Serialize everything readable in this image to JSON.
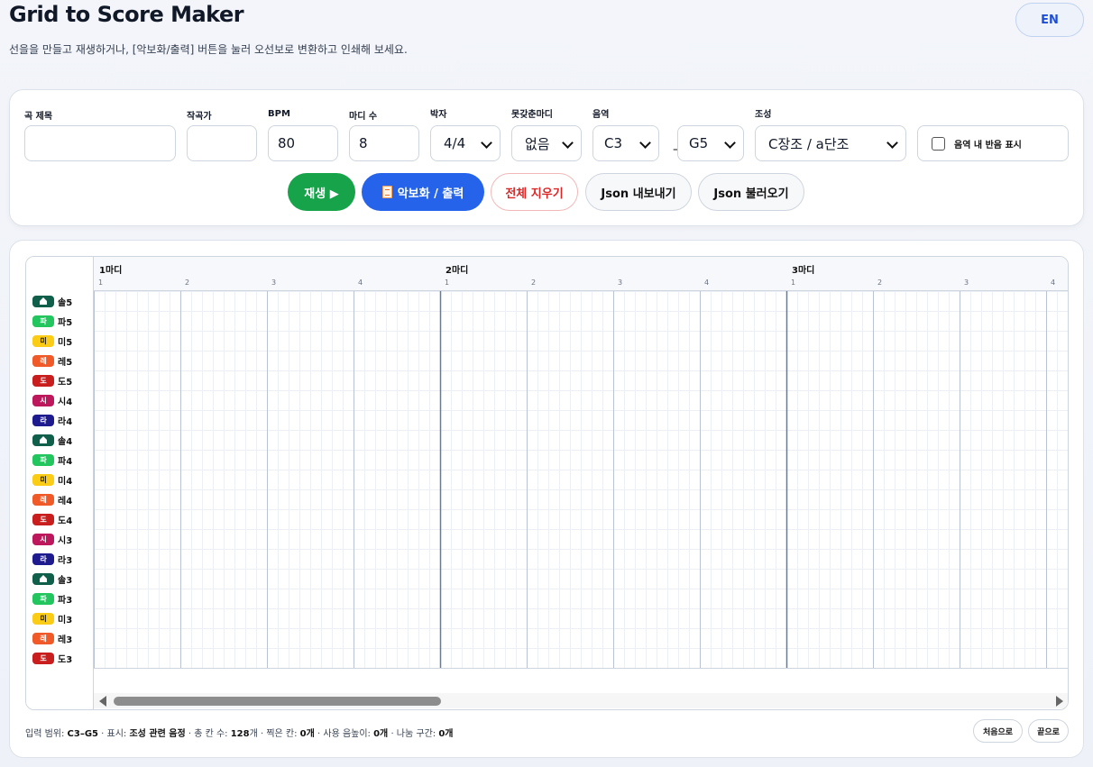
{
  "app": {
    "title": "Grid to Score Maker",
    "subtitle": "선을을 만들고 재생하거나, [악보화/출력] 버튼을 눌러 오선보로 변환하고 인쇄해 보세요.",
    "lang_button": "EN"
  },
  "settings": {
    "song_title": {
      "label": "곡 제목",
      "value": ""
    },
    "composer": {
      "label": "작곡가",
      "value": ""
    },
    "bpm": {
      "label": "BPM",
      "value": "80"
    },
    "measures": {
      "label": "마디 수",
      "value": "8"
    },
    "time_signature": {
      "label": "박자",
      "value": "4/4"
    },
    "pickup": {
      "label": "못갖춘마디",
      "value": "없음"
    },
    "range": {
      "label": "음역",
      "low": "C3",
      "high": "G5",
      "separator": "–"
    },
    "key": {
      "label": "조성",
      "value": "C장조 / a단조"
    },
    "show_semitones": {
      "label": "음역 내 반음 표시",
      "checked": false
    }
  },
  "buttons": {
    "play": "재생 ▶",
    "score": "악보화 / 출력",
    "clear": "전체 지우기",
    "export_json": "Json 내보내기",
    "import_json": "Json 불러오기"
  },
  "grid": {
    "measures": [
      "1마디",
      "2마디",
      "3마디"
    ],
    "beats": [
      "1",
      "2",
      "3",
      "4",
      "1",
      "2",
      "3",
      "4",
      "1",
      "2",
      "3",
      "4"
    ],
    "rows": [
      {
        "badge": "",
        "label": "솔5",
        "color": "#0f5f4a",
        "icon": "home-icon"
      },
      {
        "badge": "파",
        "label": "파5",
        "color": "#22c55e"
      },
      {
        "badge": "미",
        "label": "미5",
        "color": "#facc15"
      },
      {
        "badge": "레",
        "label": "레5",
        "color": "#f05a28"
      },
      {
        "badge": "도",
        "label": "도5",
        "color": "#c81e1e"
      },
      {
        "badge": "시",
        "label": "시4",
        "color": "#be185d"
      },
      {
        "badge": "라",
        "label": "라4",
        "color": "#1e1b8f"
      },
      {
        "badge": "",
        "label": "솔4",
        "color": "#0f5f4a",
        "icon": "home-icon"
      },
      {
        "badge": "파",
        "label": "파4",
        "color": "#22c55e"
      },
      {
        "badge": "미",
        "label": "미4",
        "color": "#facc15"
      },
      {
        "badge": "레",
        "label": "레4",
        "color": "#f05a28"
      },
      {
        "badge": "도",
        "label": "도4",
        "color": "#c81e1e"
      },
      {
        "badge": "시",
        "label": "시3",
        "color": "#be185d"
      },
      {
        "badge": "라",
        "label": "라3",
        "color": "#1e1b8f"
      },
      {
        "badge": "",
        "label": "솔3",
        "color": "#0f5f4a",
        "icon": "home-icon"
      },
      {
        "badge": "파",
        "label": "파3",
        "color": "#22c55e"
      },
      {
        "badge": "미",
        "label": "미3",
        "color": "#facc15"
      },
      {
        "badge": "레",
        "label": "레3",
        "color": "#f05a28"
      },
      {
        "badge": "도",
        "label": "도3",
        "color": "#c81e1e"
      }
    ]
  },
  "status": {
    "range_label": "입력 범위: ",
    "range_value": "C3–G5",
    "display_label": " · 표시: ",
    "display_value": "조성 관련 음정",
    "cells_label": " · 총 칸 수: ",
    "cells_value": "128",
    "cells_unit": "개",
    "filled_label": " · 찍은 칸: ",
    "filled_value": "0개",
    "notes_label": " · 사용 음높이: ",
    "notes_value": "0개",
    "split_label": " · 나눔 구간: ",
    "split_value": "0개",
    "to_start": "처음으로",
    "to_end": "끝으로"
  }
}
